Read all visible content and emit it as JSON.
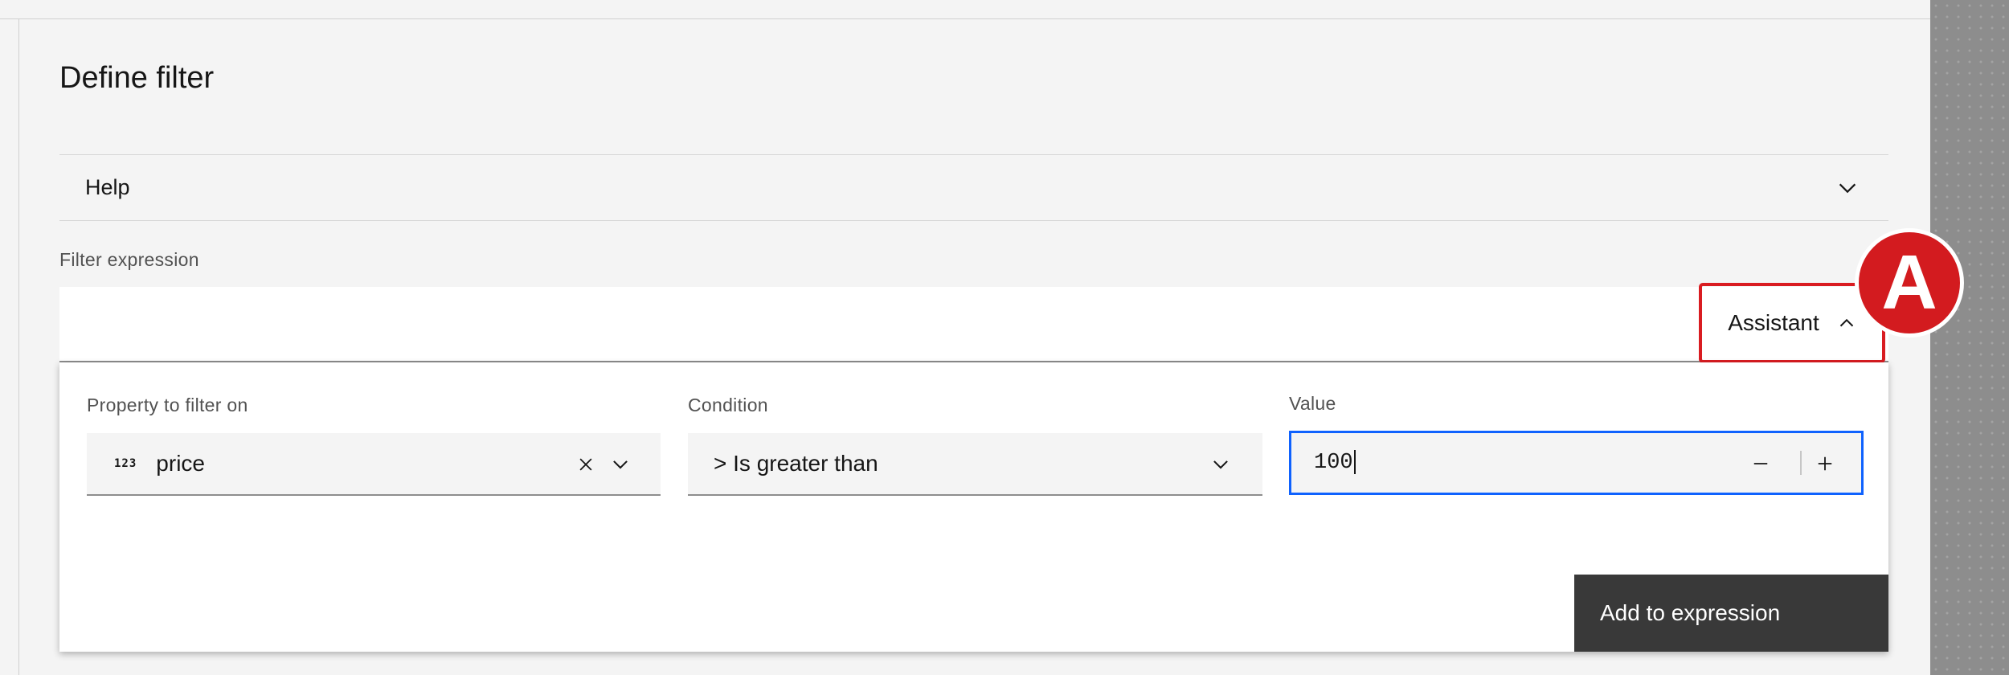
{
  "page": {
    "title": "Define filter"
  },
  "help": {
    "label": "Help"
  },
  "filter_expression": {
    "label": "Filter expression",
    "assistant_label": "Assistant"
  },
  "annotation": {
    "badge": "A"
  },
  "assistant": {
    "property": {
      "label": "Property to filter on",
      "type_icon": "123",
      "value": "price"
    },
    "condition": {
      "label": "Condition",
      "value": "> Is greater than"
    },
    "value": {
      "label": "Value",
      "current": "100"
    },
    "add_button": "Add to expression"
  },
  "colors": {
    "focus_border": "#0f62fe",
    "highlight_red": "#d91c21",
    "dark_button": "#393939"
  }
}
